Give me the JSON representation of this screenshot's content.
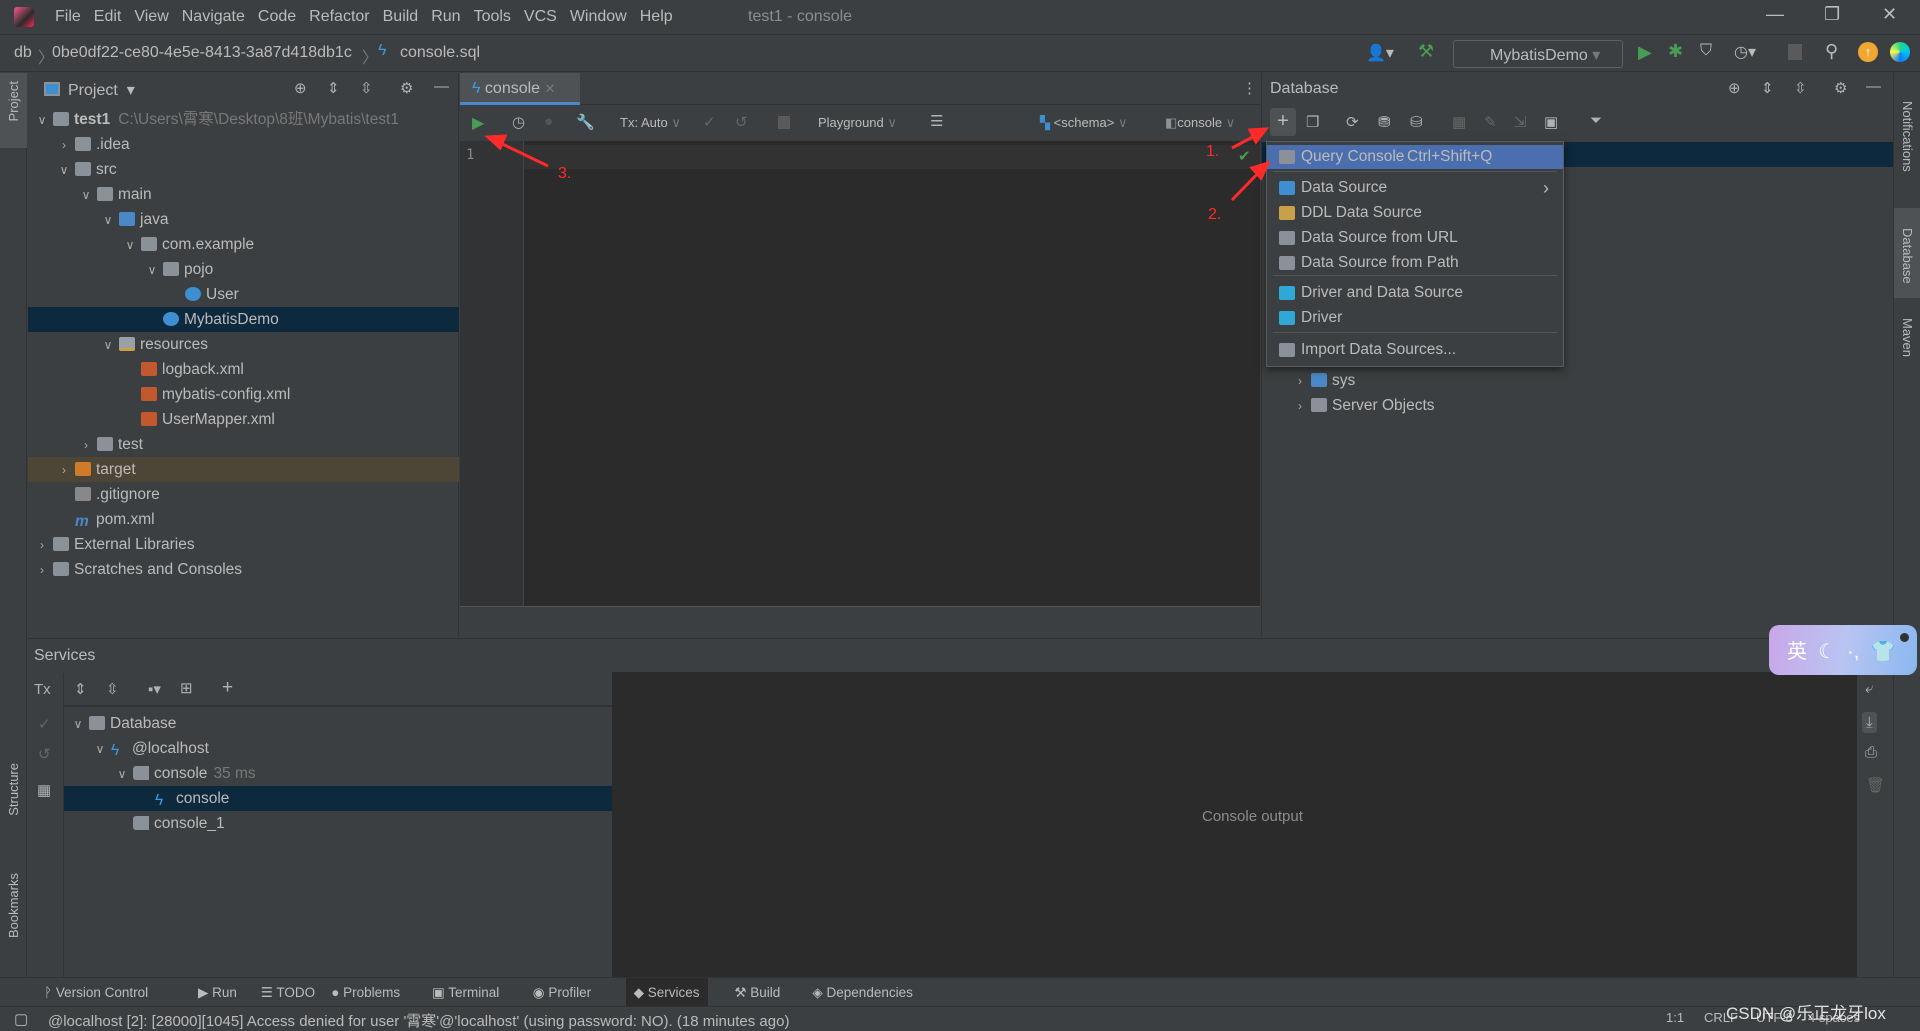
{
  "window": {
    "title": "test1 - console",
    "menu": [
      "File",
      "Edit",
      "View",
      "Navigate",
      "Code",
      "Refactor",
      "Build",
      "Run",
      "Tools",
      "VCS",
      "Window",
      "Help"
    ]
  },
  "breadcrumb": [
    "db",
    "0be0df22-ce80-4e5e-8413-3a87d418db1c",
    "console.sql"
  ],
  "run_config": "MybatisDemo",
  "project": {
    "title": "Project",
    "tree": [
      {
        "label": "test1",
        "path": "C:\\Users\\霄寒\\Desktop\\8班\\Mybatis\\test1",
        "depth": 0,
        "open": true,
        "icon": "folder",
        "bold": true
      },
      {
        "label": ".idea",
        "depth": 1,
        "open": false,
        "icon": "folder"
      },
      {
        "label": "src",
        "depth": 1,
        "open": true,
        "icon": "folder"
      },
      {
        "label": "main",
        "depth": 2,
        "open": true,
        "icon": "folder"
      },
      {
        "label": "java",
        "depth": 3,
        "open": true,
        "icon": "jfolder"
      },
      {
        "label": "com.example",
        "depth": 4,
        "open": true,
        "icon": "folder"
      },
      {
        "label": "pojo",
        "depth": 5,
        "open": true,
        "icon": "folder"
      },
      {
        "label": "User",
        "depth": 6,
        "icon": "cls"
      },
      {
        "label": "MybatisDemo",
        "depth": 5,
        "icon": "cls",
        "selected": true
      },
      {
        "label": "resources",
        "depth": 3,
        "open": true,
        "icon": "resfolder"
      },
      {
        "label": "logback.xml",
        "depth": 4,
        "icon": "xml"
      },
      {
        "label": "mybatis-config.xml",
        "depth": 4,
        "icon": "xml"
      },
      {
        "label": "UserMapper.xml",
        "depth": 4,
        "icon": "xml"
      },
      {
        "label": "test",
        "depth": 2,
        "open": false,
        "icon": "folder"
      },
      {
        "label": "target",
        "depth": 1,
        "open": false,
        "icon": "orange",
        "highlight": true
      },
      {
        "label": ".gitignore",
        "depth": 1,
        "icon": "file"
      },
      {
        "label": "pom.xml",
        "depth": 1,
        "icon": "mav"
      },
      {
        "label": "External Libraries",
        "depth": 0,
        "open": false,
        "icon": "lib"
      },
      {
        "label": "Scratches and Consoles",
        "depth": 0,
        "open": false,
        "icon": "lib"
      }
    ]
  },
  "editor": {
    "tab": "console",
    "tx": "Tx: Auto",
    "playground": "Playground",
    "schema": "<schema>",
    "session": "console",
    "line": "1"
  },
  "database": {
    "title": "Database",
    "tree": [
      {
        "label": "sys",
        "icon": "folder"
      },
      {
        "label": "Server Objects",
        "icon": "folder"
      }
    ]
  },
  "add_menu": [
    {
      "label": "Query Console",
      "shortcut": "Ctrl+Shift+Q",
      "icon": "query-console-icon",
      "highlighted": true
    },
    {
      "label": "Data Source",
      "submenu": true,
      "icon": "database-icon"
    },
    {
      "label": "DDL Data Source",
      "icon": "ddl-icon"
    },
    {
      "label": "Data Source from URL",
      "icon": "plug-icon"
    },
    {
      "label": "Data Source from Path",
      "icon": "folder-open-icon"
    },
    {
      "label": "Driver and Data Source",
      "icon": "driver-icon"
    },
    {
      "label": "Driver",
      "icon": "driver-icon"
    },
    {
      "label": "Import Data Sources...",
      "icon": "import-icon"
    }
  ],
  "annotations": [
    "1.",
    "2.",
    "3."
  ],
  "services": {
    "title": "Services",
    "tx": "Tx",
    "console_output": "Console output",
    "tree": [
      {
        "label": "Database",
        "depth": 0,
        "open": true,
        "icon": "folder"
      },
      {
        "label": "@localhost",
        "depth": 1,
        "open": true,
        "icon": "sql"
      },
      {
        "label": "console",
        "extra": "35 ms",
        "depth": 2,
        "open": true,
        "icon": "conn"
      },
      {
        "label": "console",
        "depth": 3,
        "icon": "sql",
        "selected": true
      },
      {
        "label": "console_1",
        "depth": 2,
        "icon": "conn"
      }
    ]
  },
  "ime": "英",
  "bottom_tabs": [
    "Version Control",
    "Run",
    "TODO",
    "Problems",
    "Terminal",
    "Profiler",
    "Services",
    "Build",
    "Dependencies"
  ],
  "active_bottom_tab": "Services",
  "status": {
    "message": "@localhost [2]: [28000][1045] Access denied for user '霄寒'@'localhost' (using password: NO). (18 minutes ago)",
    "position": "1:1",
    "line_sep": "CRLF",
    "encoding": "UTF-8",
    "indent": "4 spaces"
  },
  "watermark": "CSDN @乐正龙牙lox",
  "side_labels": {
    "project": "Project",
    "notifications": "Notifications",
    "database": "Database",
    "maven": "Maven",
    "structure": "Structure",
    "bookmarks": "Bookmarks"
  },
  "colors": {
    "bg": "#3c3f41",
    "editor": "#2b2b2b",
    "selection": "#0d293e",
    "menu_highlight": "#4b6eaf",
    "run": "#499c54",
    "annotation": "#ff2a2a"
  }
}
